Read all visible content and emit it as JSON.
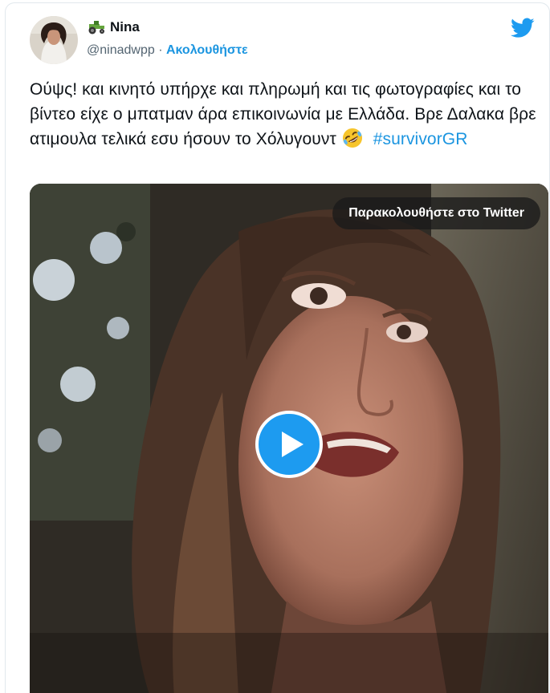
{
  "tweet": {
    "author_name": "Nina",
    "handle": "@ninadwpp",
    "separator": "·",
    "follow_label": "Ακολουθήστε",
    "text_main": "Ούψς! και κινητό υπήρχε και πληρωμή και τις φωτογραφίες και το βίντεο είχε ο μπατμαν άρα επικοινωνία με Ελλάδα. Βρε Δαλακα βρε ατιμουλα τελικά εσυ ήσουν το Χόλυγουντ",
    "emoji": "rolling-on-floor-laughing",
    "hashtag": "#survivorGR"
  },
  "video": {
    "watch_label": "Παρακολουθήστε στο Twitter"
  },
  "icons": {
    "brand": "twitter-bird-icon",
    "name_emoji": "tractor-icon",
    "play": "play-icon"
  },
  "colors": {
    "twitter_blue": "#1d9bf0",
    "link_blue": "#1b95e0",
    "text": "#0f1419",
    "muted": "#536471"
  }
}
